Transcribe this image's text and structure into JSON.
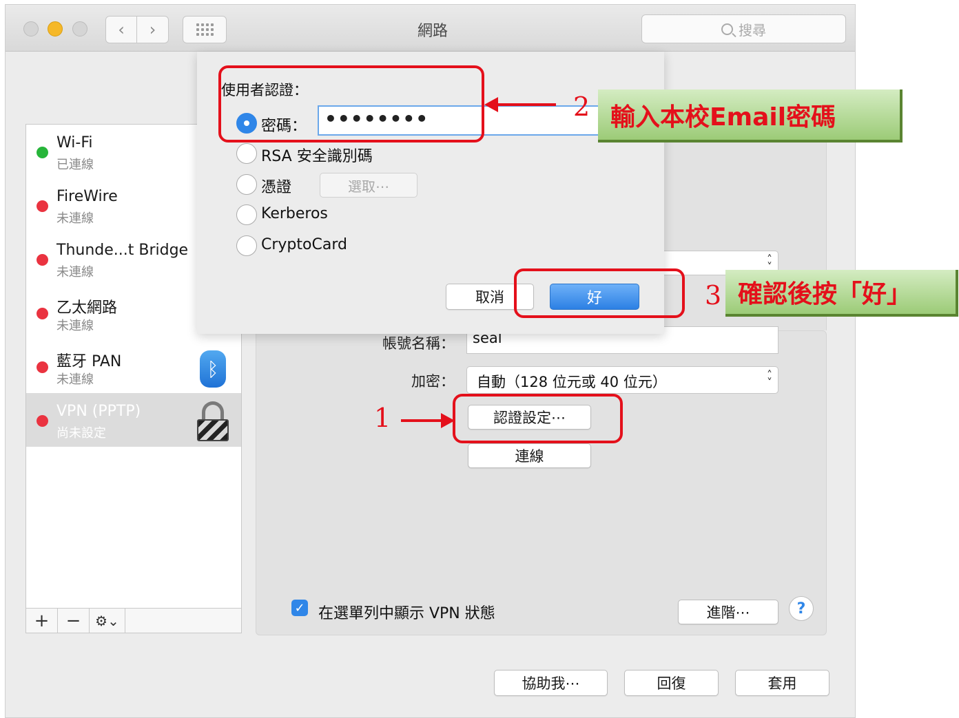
{
  "window": {
    "title": "網路",
    "search_placeholder": "搜尋",
    "nav_back_glyph": "‹",
    "nav_forward_glyph": "›"
  },
  "sidebar": {
    "services": [
      {
        "name": "Wi-Fi",
        "status": "已連線",
        "status_color": "#27b53a"
      },
      {
        "name": "FireWire",
        "status": "未連線",
        "status_color": "#ea3340"
      },
      {
        "name": "Thunde...t Bridge",
        "status": "未連線",
        "status_color": "#ea3340"
      },
      {
        "name": "乙太網路",
        "status": "未連線",
        "status_color": "#ea3340"
      },
      {
        "name": "藍牙 PAN",
        "status": "未連線",
        "status_color": "#ea3340",
        "icon": "bluetooth-icon"
      },
      {
        "name": "VPN (PPTP)",
        "status": "尚未設定",
        "status_color": "#ea3340",
        "icon": "lock-icon",
        "selected": true
      }
    ],
    "toolbar": {
      "add": "+",
      "remove": "−",
      "gear": "⚙︎⌄"
    }
  },
  "vpn": {
    "account_label": "帳號名稱：",
    "account_value": "seal",
    "encryption_label": "加密：",
    "encryption_value": "自動（128 位元或 40 位元）",
    "auth_settings_button": "認證設定⋯",
    "connect_button": "連線",
    "show_status_checkbox": "在選單列中顯示 VPN 狀態",
    "show_status_checked": true,
    "advanced_button": "進階⋯",
    "help_button": "?"
  },
  "auth_sheet": {
    "title": "使用者認證：",
    "options": [
      {
        "label": "密碼：",
        "selected": true
      },
      {
        "label": "RSA 安全識別碼",
        "selected": false
      },
      {
        "label": "憑證",
        "selected": false
      },
      {
        "label": "Kerberos",
        "selected": false
      },
      {
        "label": "CryptoCard",
        "selected": false
      }
    ],
    "password_value": "••••••••",
    "choose_button": "選取⋯",
    "cancel_button": "取消",
    "ok_button": "好"
  },
  "footer": {
    "assist_button": "協助我⋯",
    "revert_button": "回復",
    "apply_button": "套用"
  },
  "annotations": {
    "step1": "1",
    "step2": "2",
    "step3": "3",
    "callout2": "輸入本校Email密碼",
    "callout3": "確認後按「好」",
    "color": "#e4101b"
  }
}
